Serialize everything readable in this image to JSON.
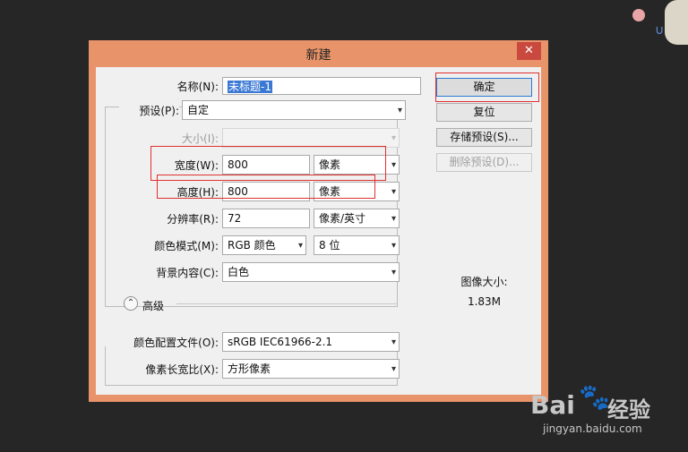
{
  "dialog": {
    "title": "新建",
    "close_icon": "close-icon",
    "fields": {
      "name": {
        "label": "名称(N):",
        "value": "未标题-1"
      },
      "preset": {
        "label": "预设(P):",
        "value": "自定"
      },
      "size": {
        "label": "大小(I):",
        "value": ""
      },
      "width": {
        "label": "宽度(W):",
        "value": "800",
        "unit": "像素"
      },
      "height": {
        "label": "高度(H):",
        "value": "800",
        "unit": "像素"
      },
      "resolution": {
        "label": "分辨率(R):",
        "value": "72",
        "unit": "像素/英寸"
      },
      "color_mode": {
        "label": "颜色模式(M):",
        "value": "RGB 颜色",
        "bits": "8 位"
      },
      "background": {
        "label": "背景内容(C):",
        "value": "白色"
      },
      "advanced": {
        "label": "高级"
      },
      "color_profile": {
        "label": "颜色配置文件(O):",
        "value": "sRGB IEC61966-2.1"
      },
      "pixel_aspect": {
        "label": "像素长宽比(X):",
        "value": "方形像素"
      }
    },
    "buttons": {
      "ok": "确定",
      "reset": "复位",
      "save_preset": "存储预设(S)...",
      "delete_preset": "删除预设(D)..."
    },
    "image_size": {
      "label": "图像大小:",
      "value": "1.83M"
    }
  },
  "watermark": {
    "brand_left": "Bai",
    "brand_right": "经验",
    "url": "jingyan.baidu.com"
  },
  "colors": {
    "dialog_frame": "#e9936a",
    "highlight": "#e03030",
    "background": "#262626"
  }
}
